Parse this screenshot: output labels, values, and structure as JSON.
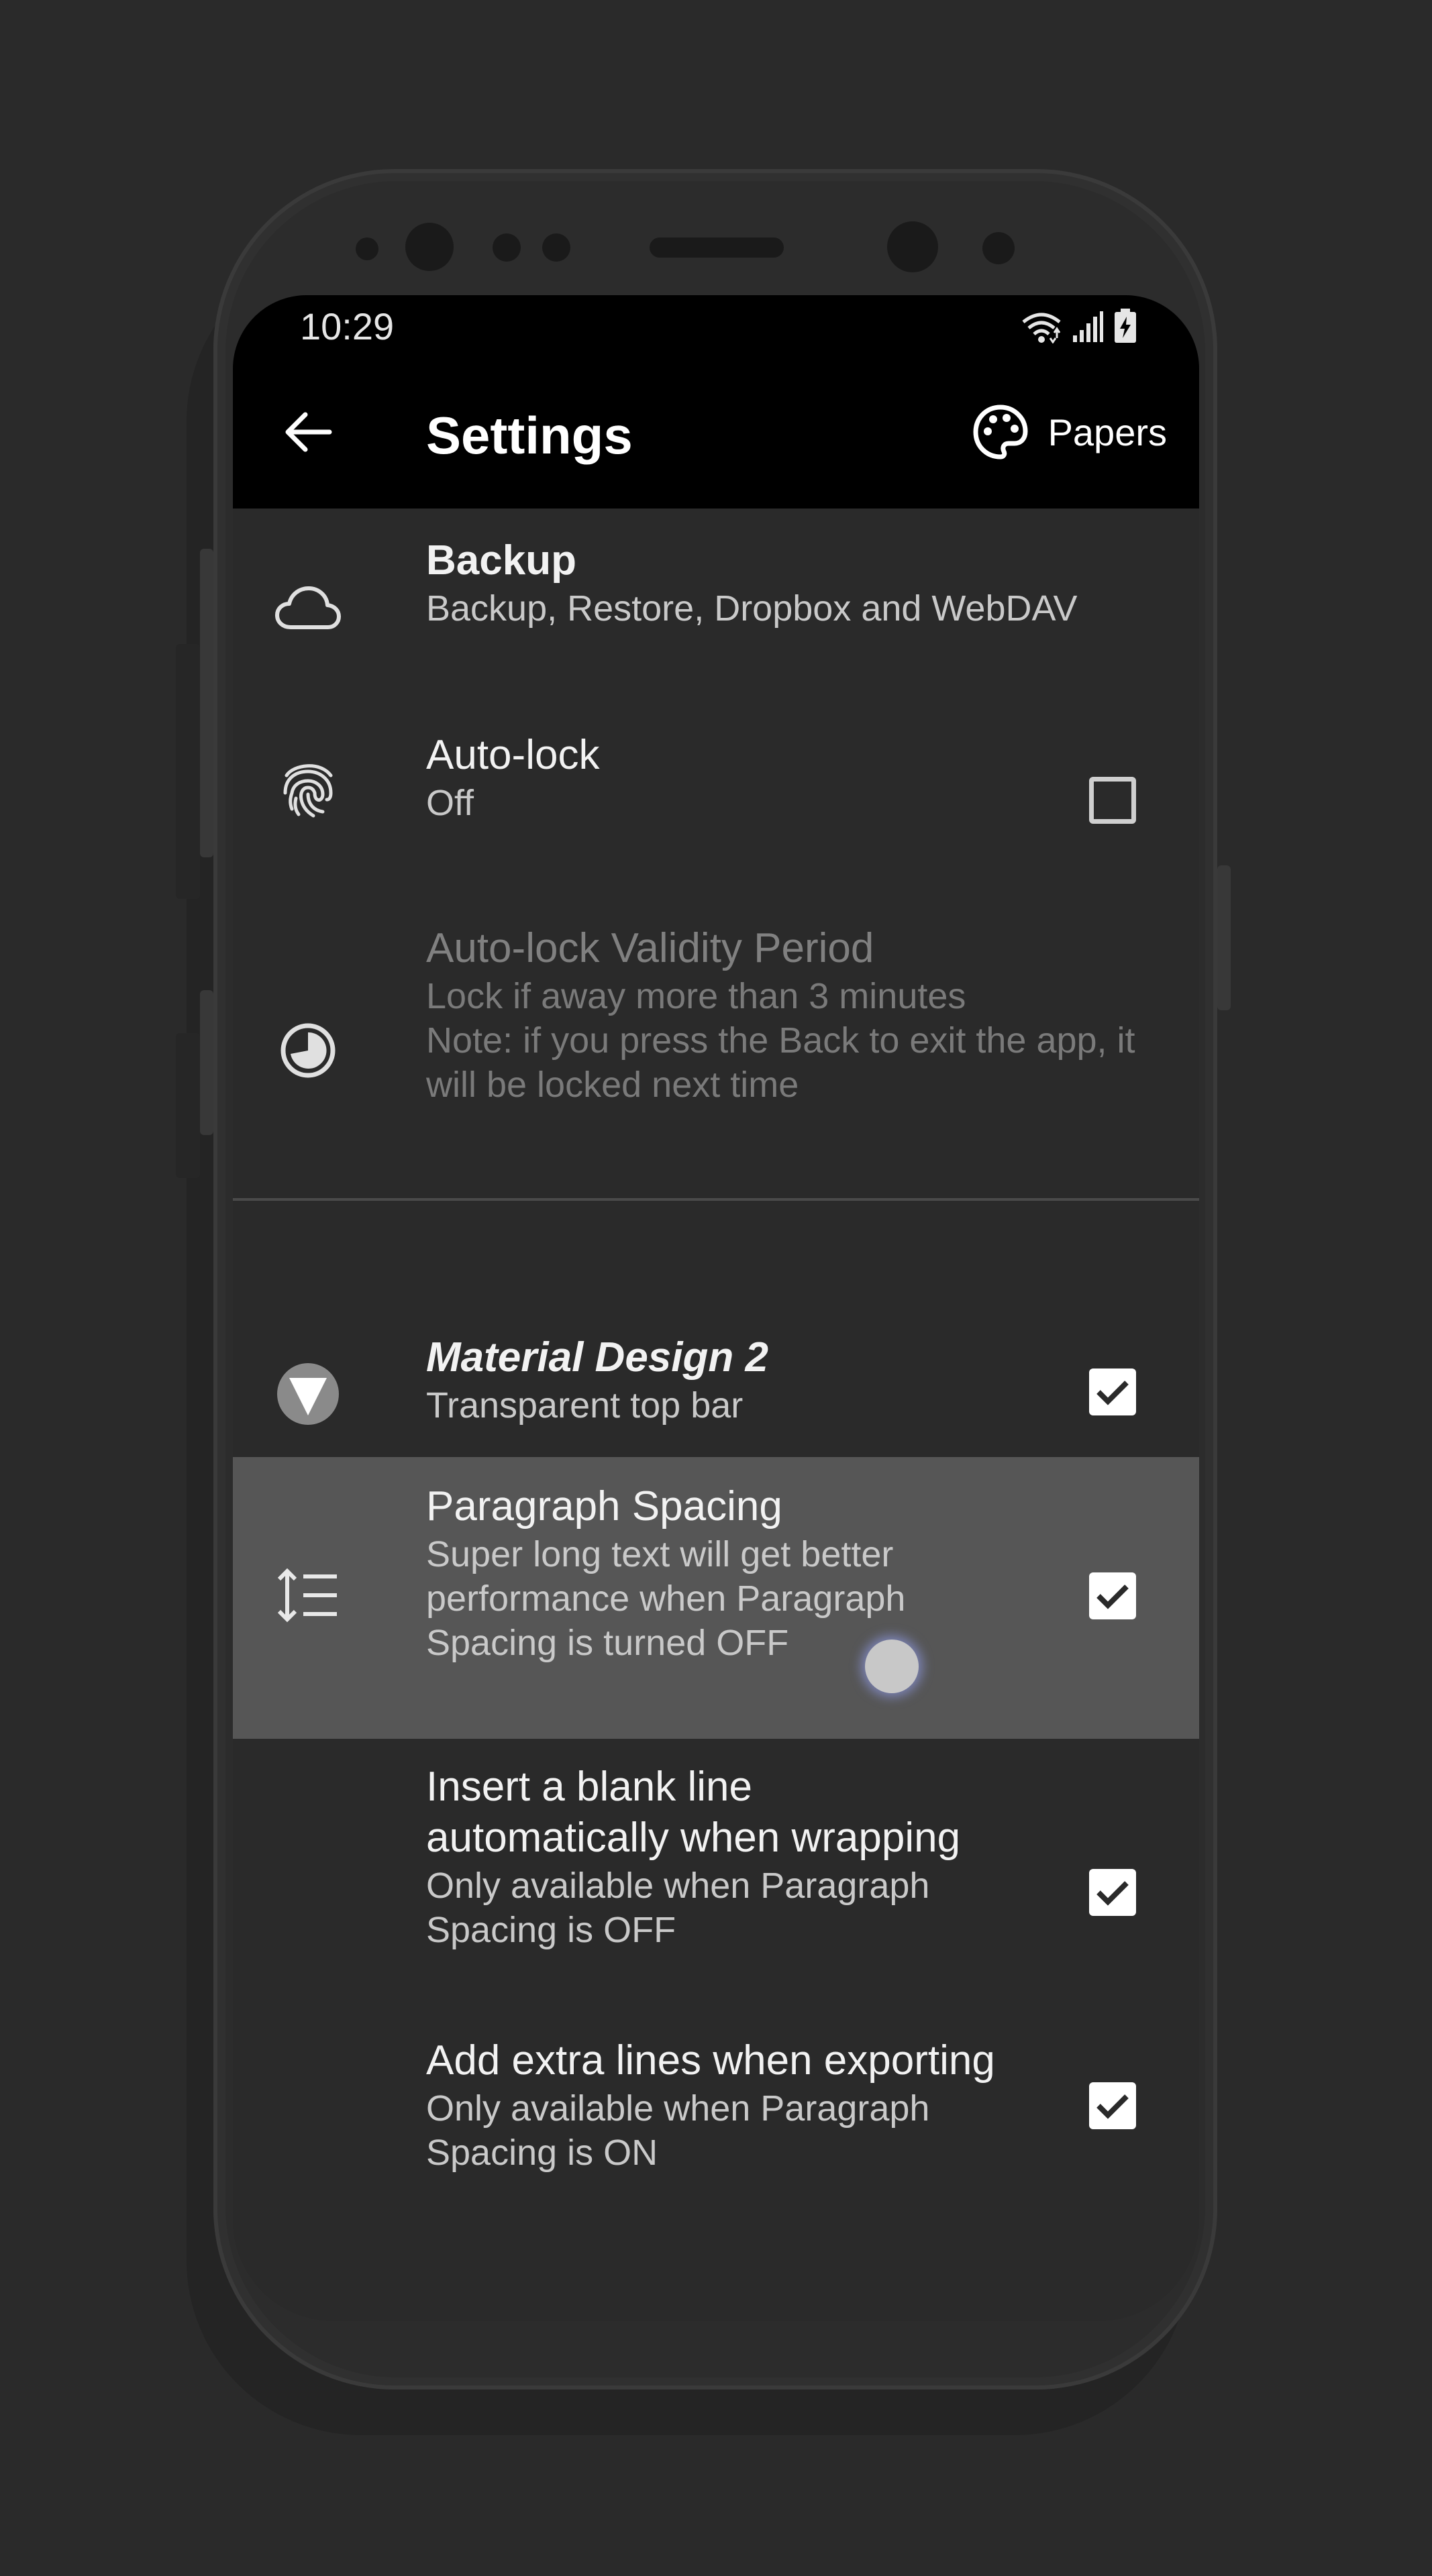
{
  "status_bar": {
    "time": "10:29",
    "icons": [
      "wifi-icon",
      "signal-icon",
      "battery-charging-icon"
    ]
  },
  "app_bar": {
    "back_icon": "arrow-left-icon",
    "title": "Settings",
    "action_icon": "palette-icon",
    "action_label": "Papers"
  },
  "settings": {
    "backup": {
      "title": "Backup",
      "subtitle": "Backup, Restore, Dropbox and WebDAV",
      "icon": "cloud-icon"
    },
    "auto_lock": {
      "title": "Auto-lock",
      "subtitle": "Off",
      "icon": "fingerprint-icon",
      "checked": false
    },
    "auto_lock_validity": {
      "title": "Auto-lock Validity Period",
      "subtitle_1": "Lock if away more than 3 minutes",
      "subtitle_2": "Note: if you press the Back to exit the app, it",
      "subtitle_3": "will be locked next time",
      "icon": "timer-icon",
      "enabled": false
    },
    "material_design": {
      "title": "Material Design 2",
      "subtitle": "Transparent top bar",
      "icon": "material-design-icon",
      "checked": true
    },
    "paragraph_spacing": {
      "title": "Paragraph Spacing",
      "subtitle_1": "Super long text will get better",
      "subtitle_2": "performance when Paragraph",
      "subtitle_3": "Spacing is turned OFF",
      "icon": "line-spacing-icon",
      "checked": true,
      "pressed": true
    },
    "insert_blank_line": {
      "title_1": "Insert a blank line",
      "title_2": "automatically when wrapping",
      "subtitle_1": "Only available when Paragraph",
      "subtitle_2": "Spacing is OFF",
      "checked": true
    },
    "extra_lines_export": {
      "title": "Add extra lines when exporting",
      "subtitle_1": "Only available when Paragraph",
      "subtitle_2": "Spacing is ON",
      "checked": true
    }
  },
  "colors": {
    "background": "#2a2a2a",
    "app_bar": "#000000",
    "highlight": "#565656",
    "checkbox": "#ffffff"
  }
}
